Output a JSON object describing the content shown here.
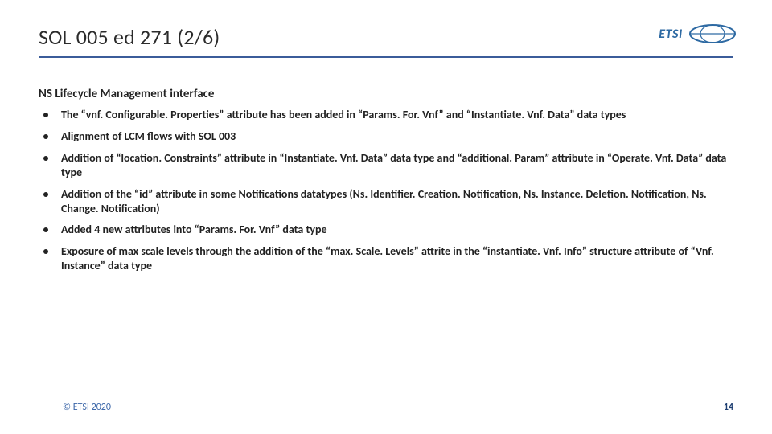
{
  "logo": {
    "text": "ETSI"
  },
  "title": "SOL 005 ed 271 (2/6)",
  "section_heading": "NS Lifecycle Management interface",
  "bullets": [
    "The “vnf. Configurable. Properties” attribute has been added in “Params. For. Vnf” and “Instantiate. Vnf. Data” data types",
    "Alignment of LCM flows with SOL 003",
    "Addition of “location. Constraints” attribute in “Instantiate. Vnf. Data” data type and “additional. Param” attribute in “Operate. Vnf. Data” data type",
    "Addition of the “id” attribute in some Notifications datatypes (Ns. Identifier. Creation. Notification, Ns. Instance. Deletion. Notification, Ns. Change. Notification)",
    "Added 4 new attributes into “Params. For. Vnf” data type",
    "Exposure of max scale levels through the addition of the “max. Scale. Levels” attrite in the “instantiate. Vnf. Info” structure attribute of “Vnf. Instance” data type"
  ],
  "footer": {
    "copyright": "© ETSI 2020",
    "page": "14"
  }
}
